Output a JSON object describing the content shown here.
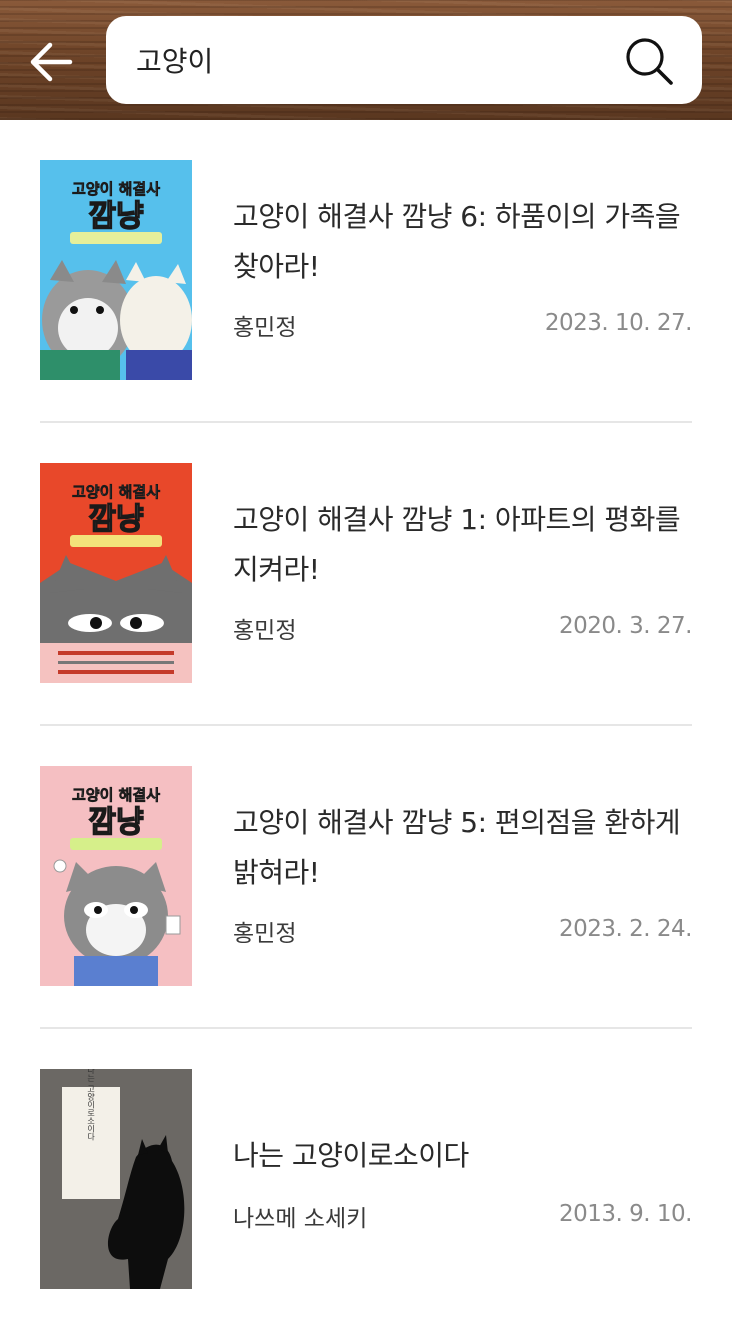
{
  "header": {
    "back_icon": "arrow-left-icon",
    "search_value": "고양이",
    "search_icon": "search-icon"
  },
  "results": [
    {
      "title": "고양이 해결사 깜냥 6: 하품이의 가족을 찾아라!",
      "author": "홍민정",
      "date": "2023. 10. 27.",
      "cover": {
        "bg": "#56c0ec",
        "brand": "고양이 해결사",
        "name": "깜냥"
      }
    },
    {
      "title": "고양이 해결사 깜냥 1: 아파트의 평화를 지켜라!",
      "author": "홍민정",
      "date": "2020. 3. 27.",
      "cover": {
        "bg": "#e8482a",
        "brand": "고양이 해결사",
        "name": "깜냥"
      }
    },
    {
      "title": "고양이 해결사 깜냥 5: 편의점을 환하게 밝혀라!",
      "author": "홍민정",
      "date": "2023. 2. 24.",
      "cover": {
        "bg": "#f5bfc2",
        "brand": "고양이 해결사",
        "name": "깜냥"
      }
    },
    {
      "title": "나는 고양이로소이다",
      "author": "나쓰메 소세키",
      "date": "2013. 9. 10.",
      "cover": {
        "bg": "#6b6864",
        "brand": "나는 고양이로소이다"
      }
    }
  ],
  "colors": {
    "header_wood": "#6e4428",
    "title_text": "#2a2a2a",
    "date_text": "#8a8a8a",
    "divider": "#e6e6e6"
  }
}
